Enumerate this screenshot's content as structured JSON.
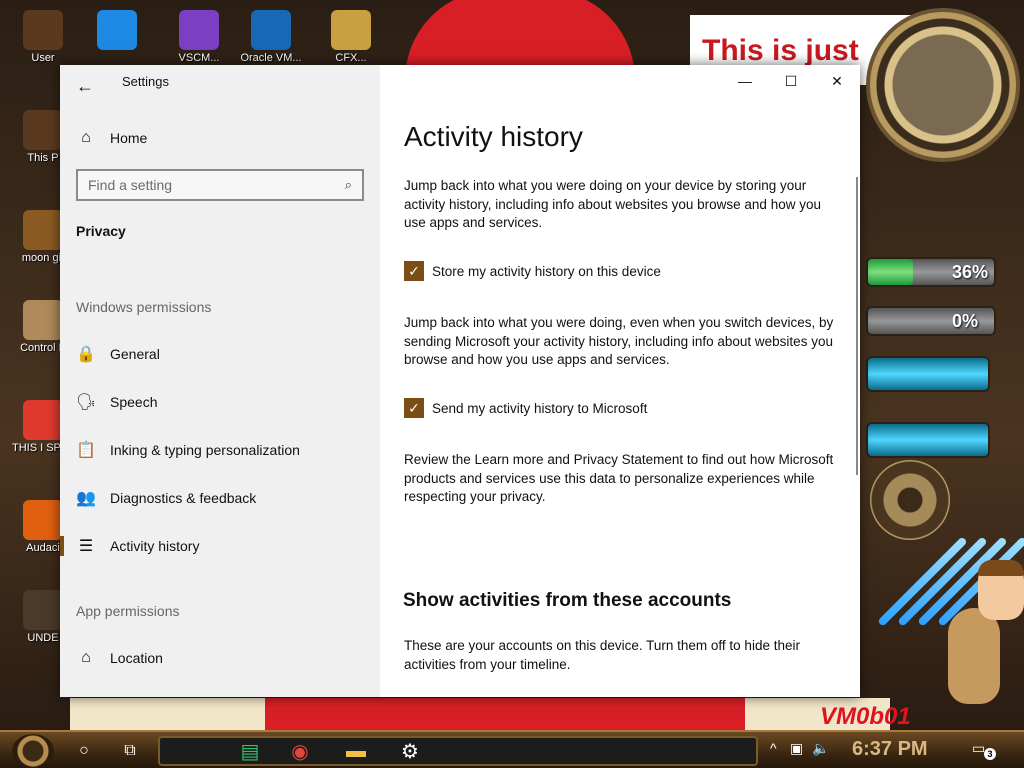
{
  "desktop": {
    "banner_text": "This is just",
    "gauges": [
      {
        "label": "36%",
        "level": 0.36
      },
      {
        "label": "0%",
        "level": 0.0
      }
    ],
    "graffiti": "VM0b01",
    "icons": [
      {
        "label": "User",
        "name": "user-folder-icon",
        "color": "#5a3a1e"
      },
      {
        "label": "",
        "name": "edge-icon",
        "color": "#1e88e5"
      },
      {
        "label": "VSCM...",
        "name": "visual-studio-icon",
        "color": "#7b3fc4"
      },
      {
        "label": "Oracle VM...",
        "name": "virtualbox-icon",
        "color": "#1769b5"
      },
      {
        "label": "CFX...",
        "name": "hxd-icon",
        "color": "#c8a040"
      },
      {
        "label": "This P",
        "name": "this-pc-icon",
        "color": "#5a3a1e"
      },
      {
        "label": "moon git",
        "name": "moon-git-icon",
        "color": "#8a5a22"
      },
      {
        "label": "Control P",
        "name": "control-panel-icon",
        "color": "#b08a5a"
      },
      {
        "label": "THIS I SPYWA",
        "name": "chrome-desktop-icon",
        "color": "#e03a2f"
      },
      {
        "label": "Audaci",
        "name": "audacity-icon",
        "color": "#e06010"
      },
      {
        "label": "UNDE",
        "name": "unde-icon",
        "color": "#4a3a2a"
      }
    ]
  },
  "window": {
    "title": "Settings",
    "back_glyph": "←",
    "controls": {
      "minimize": "—",
      "maximize": "☐",
      "close": "✕"
    },
    "sidebar": {
      "home": {
        "label": "Home",
        "icon": "⌂"
      },
      "search_placeholder": "Find a setting",
      "search_icon": "⌕",
      "section": "Privacy",
      "group_windows": "Windows permissions",
      "items": [
        {
          "label": "General",
          "icon": "🔒",
          "name": "sidebar-item-general",
          "icon_name": "lock-icon"
        },
        {
          "label": "Speech",
          "icon": "🗣",
          "name": "sidebar-item-speech",
          "icon_name": "speech-icon"
        },
        {
          "label": "Inking & typing personalization",
          "icon": "📋",
          "name": "sidebar-item-inking",
          "icon_name": "clipboard-icon"
        },
        {
          "label": "Diagnostics & feedback",
          "icon": "👥",
          "name": "sidebar-item-diagnostics",
          "icon_name": "feedback-icon"
        },
        {
          "label": "Activity history",
          "icon": "☰",
          "name": "sidebar-item-activity",
          "icon_name": "activity-icon"
        }
      ],
      "group_app": "App permissions",
      "location": {
        "label": "Location",
        "icon": "⌂"
      }
    },
    "content": {
      "title": "Activity history",
      "intro": "Jump back into what you were doing on your device by storing your activity history, including info about websites you browse and how you use apps and services.",
      "check_store": {
        "label": "Store my activity history on this device",
        "checked": true
      },
      "desc_send": "Jump back into what you were doing, even when you switch devices, by sending Microsoft your activity history, including info about websites you browse and how you use apps and services.",
      "check_send": {
        "label": "Send my activity history to Microsoft",
        "checked": true
      },
      "review": "Review the Learn more and Privacy Statement to find out how Microsoft products and services use this data to personalize experiences while respecting your privacy.",
      "accounts_heading": "Show activities from these accounts",
      "accounts_desc": "These are your accounts on this device. Turn them off to hide their activities from your timeline."
    }
  },
  "taskbar": {
    "time": "6:37 PM",
    "notification_count": "3",
    "search_glyph": "○",
    "taskview_glyph": "⧉",
    "apps": [
      {
        "name": "sticky-notes-icon",
        "glyph": "▤",
        "color": "#2ec36a"
      },
      {
        "name": "chrome-icon",
        "glyph": "◉",
        "color": "#e0463a"
      },
      {
        "name": "file-explorer-icon",
        "glyph": "▬",
        "color": "#f2c046"
      },
      {
        "name": "settings-taskbar-icon",
        "glyph": "⚙",
        "color": "#ffffff"
      }
    ],
    "tray": {
      "chevron": "^",
      "network": "▣",
      "volume": "🔈"
    }
  },
  "colors": {
    "accent": "#7a4e14",
    "sidebar_bg": "#f0f0f0",
    "banner_text": "#c9191f"
  }
}
